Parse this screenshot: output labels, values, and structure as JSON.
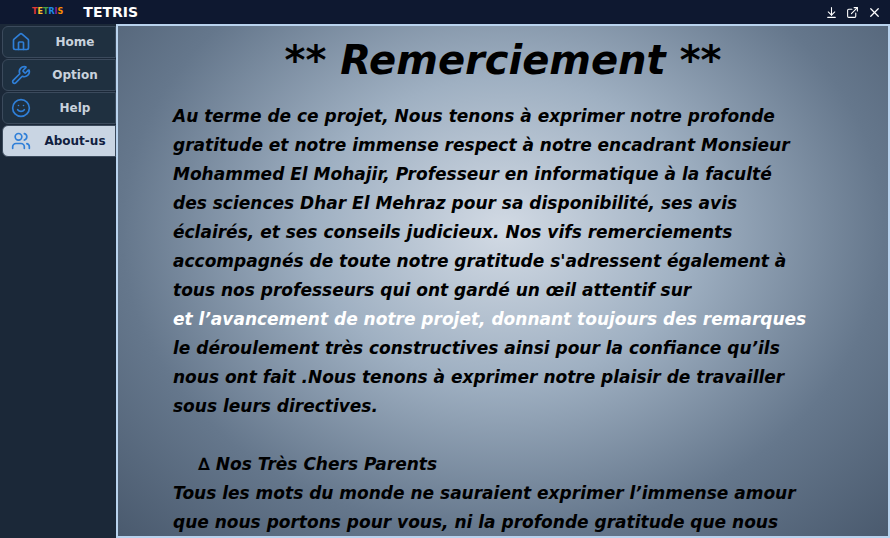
{
  "window": {
    "title": "TETRIS",
    "logo": "TETRIS"
  },
  "sidebar": {
    "items": [
      {
        "label": "Home",
        "selected": false
      },
      {
        "label": "Option",
        "selected": false
      },
      {
        "label": "Help",
        "selected": false
      },
      {
        "label": "About-us",
        "selected": true
      }
    ]
  },
  "content": {
    "heading": "** Remerciement **",
    "lines": [
      {
        "text": "Au terme de ce projet, Nous tenons à exprimer notre profonde",
        "color": "#000000"
      },
      {
        "text": "gratitude et notre immense respect à notre encadrant Monsieur",
        "color": "#000000"
      },
      {
        "text": "Mohammed El Mohajir, Professeur  en informatique à la faculté",
        "color": "#000000"
      },
      {
        "text": "des sciences Dhar El Mehraz pour sa disponibilité, ses avis",
        "color": "#000000"
      },
      {
        "text": "éclairés, et ses conseils judicieux. Nos vifs remerciements",
        "color": "#000000"
      },
      {
        "text": "accompagnés de toute notre gratitude s'adressent également à",
        "color": "#000000"
      },
      {
        "text": "tous nos professeurs qui ont gardé un œil attentif sur",
        "color": "#000000"
      },
      {
        "text": "et l’avancement de notre projet, donnant toujours des remarques",
        "color": "#ffffff"
      },
      {
        "text": "le déroulement très constructives ainsi pour la confiance qu’ils",
        "color": "#000000"
      },
      {
        "text": "nous ont fait .Nous  tenons à exprimer notre plaisir de travailler",
        "color": "#000000"
      },
      {
        "text": "sous leurs directives.",
        "color": "#000000"
      }
    ],
    "subheading": "∆ Nos Très Chers Parents",
    "lines2": [
      {
        "text": "Tous les mots du monde ne sauraient exprimer l’immense amour",
        "color": "#000000"
      },
      {
        "text": "que nous portons pour vous, ni la profonde gratitude que nous",
        "color": "#000000"
      }
    ]
  }
}
